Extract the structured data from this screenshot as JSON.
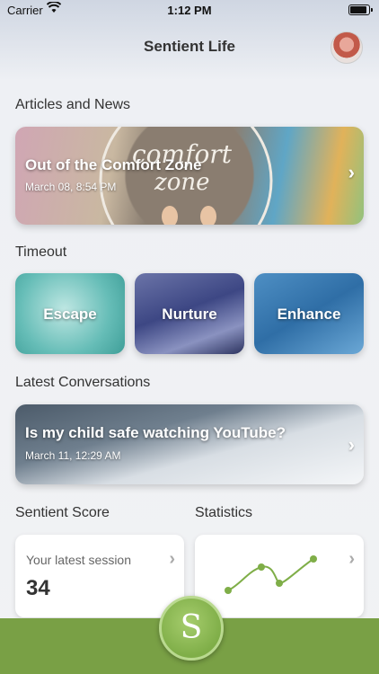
{
  "status_bar": {
    "carrier": "Carrier",
    "time": "1:12 PM",
    "battery_level": 0.9
  },
  "nav": {
    "title": "Sentient Life"
  },
  "sections": {
    "articles": "Articles and News",
    "timeout": "Timeout",
    "conversations": "Latest Conversations",
    "score": "Sentient Score",
    "statistics": "Statistics"
  },
  "article": {
    "title": "Out of the Comfort Zone",
    "date": "March 08, 8:54 PM",
    "image_text": "comfort zone"
  },
  "timeout_cards": [
    {
      "label": "Escape"
    },
    {
      "label": "Nurture"
    },
    {
      "label": "Enhance"
    }
  ],
  "conversation": {
    "title": "Is my child safe watching YouTube?",
    "date": "March 11, 12:29 AM"
  },
  "score_card": {
    "label": "Your latest session",
    "value": "34"
  },
  "fab": {
    "symbol": "S"
  },
  "colors": {
    "accent_green": "#79a045",
    "fab_green": "#8fbd56",
    "line_green": "#7fae48"
  },
  "icons": {
    "chevron": "chevron-right-icon",
    "wifi": "wifi-icon",
    "battery": "battery-icon",
    "avatar": "anatomy-avatar"
  }
}
